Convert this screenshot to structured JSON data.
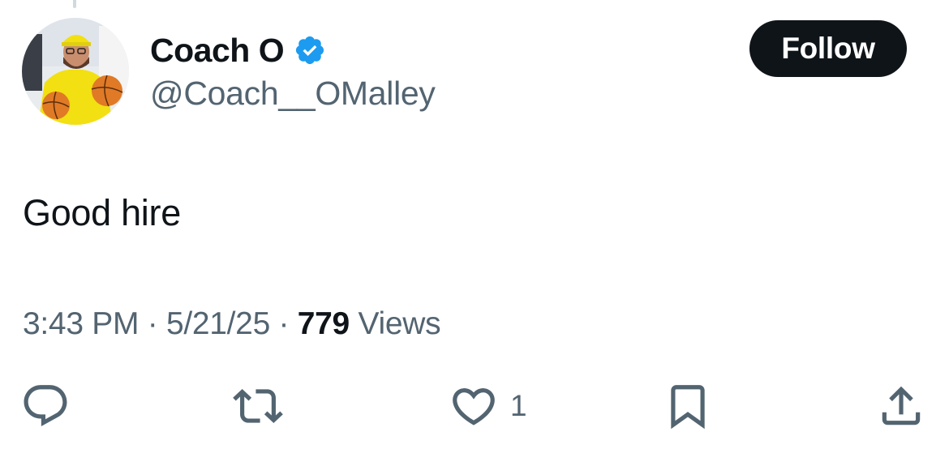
{
  "author": {
    "display_name": "Coach O",
    "handle": "@Coach__OMalley",
    "verified": true
  },
  "follow_button": {
    "label": "Follow"
  },
  "tweet": {
    "text": "Good hire",
    "time": "3:43 PM",
    "date": "5/21/25",
    "views_count": "779",
    "views_label": "Views",
    "separator": "·"
  },
  "actions": {
    "reply": {
      "icon": "reply-icon"
    },
    "retweet": {
      "icon": "retweet-icon"
    },
    "like": {
      "icon": "heart-icon",
      "count": "1"
    },
    "bookmark": {
      "icon": "bookmark-icon"
    },
    "share": {
      "icon": "share-icon"
    }
  },
  "colors": {
    "text_primary": "#0f1419",
    "text_secondary": "#536471",
    "verified_blue": "#1d9bf0",
    "button_bg": "#0f1419"
  }
}
